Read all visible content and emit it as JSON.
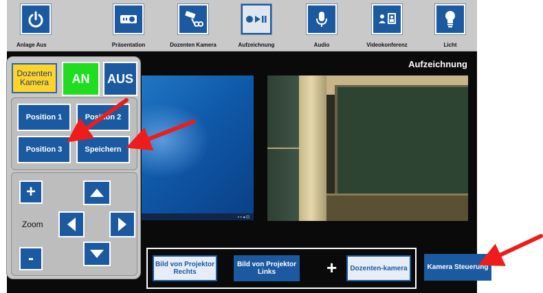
{
  "topbar": {
    "items": [
      {
        "label": "Anlage Aus",
        "icon": "power-icon"
      },
      {
        "label": "Präsentation",
        "icon": "projector-icon"
      },
      {
        "label": "Dozenten Kamera",
        "icon": "camera-icon"
      },
      {
        "label": "Aufzeichnung",
        "icon": "record-play-icon"
      },
      {
        "label": "Audio",
        "icon": "microphone-icon"
      },
      {
        "label": "Videokonferenz",
        "icon": "videoconference-icon"
      },
      {
        "label": "Licht",
        "icon": "lightbulb-icon"
      }
    ]
  },
  "main": {
    "title": "Aufzeichnung"
  },
  "panel": {
    "camera_label": "Dozenten Kamera",
    "on_label": "AN",
    "off_label": "AUS",
    "position1": "Position 1",
    "position2": "Position 2",
    "position3": "Position 3",
    "save": "Speichern",
    "zoom_in": "+",
    "zoom_out": "-",
    "zoom_label": "Zoom"
  },
  "bottom": {
    "source1": "Bild von Projektor Rechts",
    "source2": "Bild von Projektor Links",
    "plus": "+",
    "source3": "Dozenten-kamera",
    "camera_control": "Kamera Steuerung"
  },
  "colors": {
    "accent": "#1b5aa1",
    "on": "#20dd20",
    "camera_label_bg": "#ffd42a",
    "annotation_arrow": "#ee1c1c"
  }
}
